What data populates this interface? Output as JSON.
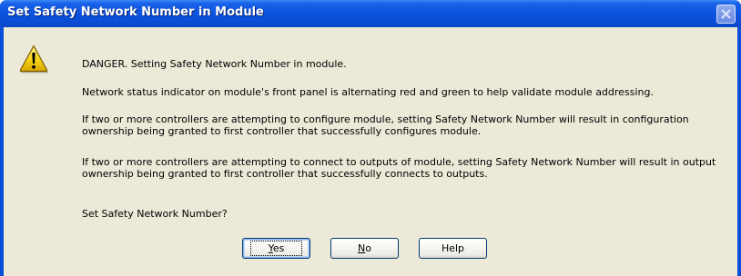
{
  "window": {
    "title": "Set Safety Network Number in Module"
  },
  "icons": {
    "title_close": "close-icon",
    "message": "warning-icon"
  },
  "message": {
    "line1": "DANGER. Setting Safety Network Number in module.",
    "line2": "Network status indicator on module's front panel is alternating red and green to help validate module addressing.",
    "line3": "If two or more controllers are attempting to configure module, setting Safety Network Number will result in configuration ownership being granted to first controller that successfully configures module.",
    "line4": "If two or more controllers are attempting to connect to outputs of module, setting Safety Network Number will result in output ownership being granted to first controller that successfully connects to outputs.",
    "line5": "Set Safety Network Number?"
  },
  "buttons": {
    "yes": {
      "mnemonic": "Y",
      "rest": "es"
    },
    "no": {
      "mnemonic": "N",
      "rest": "o"
    },
    "help": "Help"
  },
  "colors": {
    "titlebar": "#0a4fd8",
    "dialog_face": "#ece9d8",
    "warning_yellow": "#f6d31a"
  }
}
